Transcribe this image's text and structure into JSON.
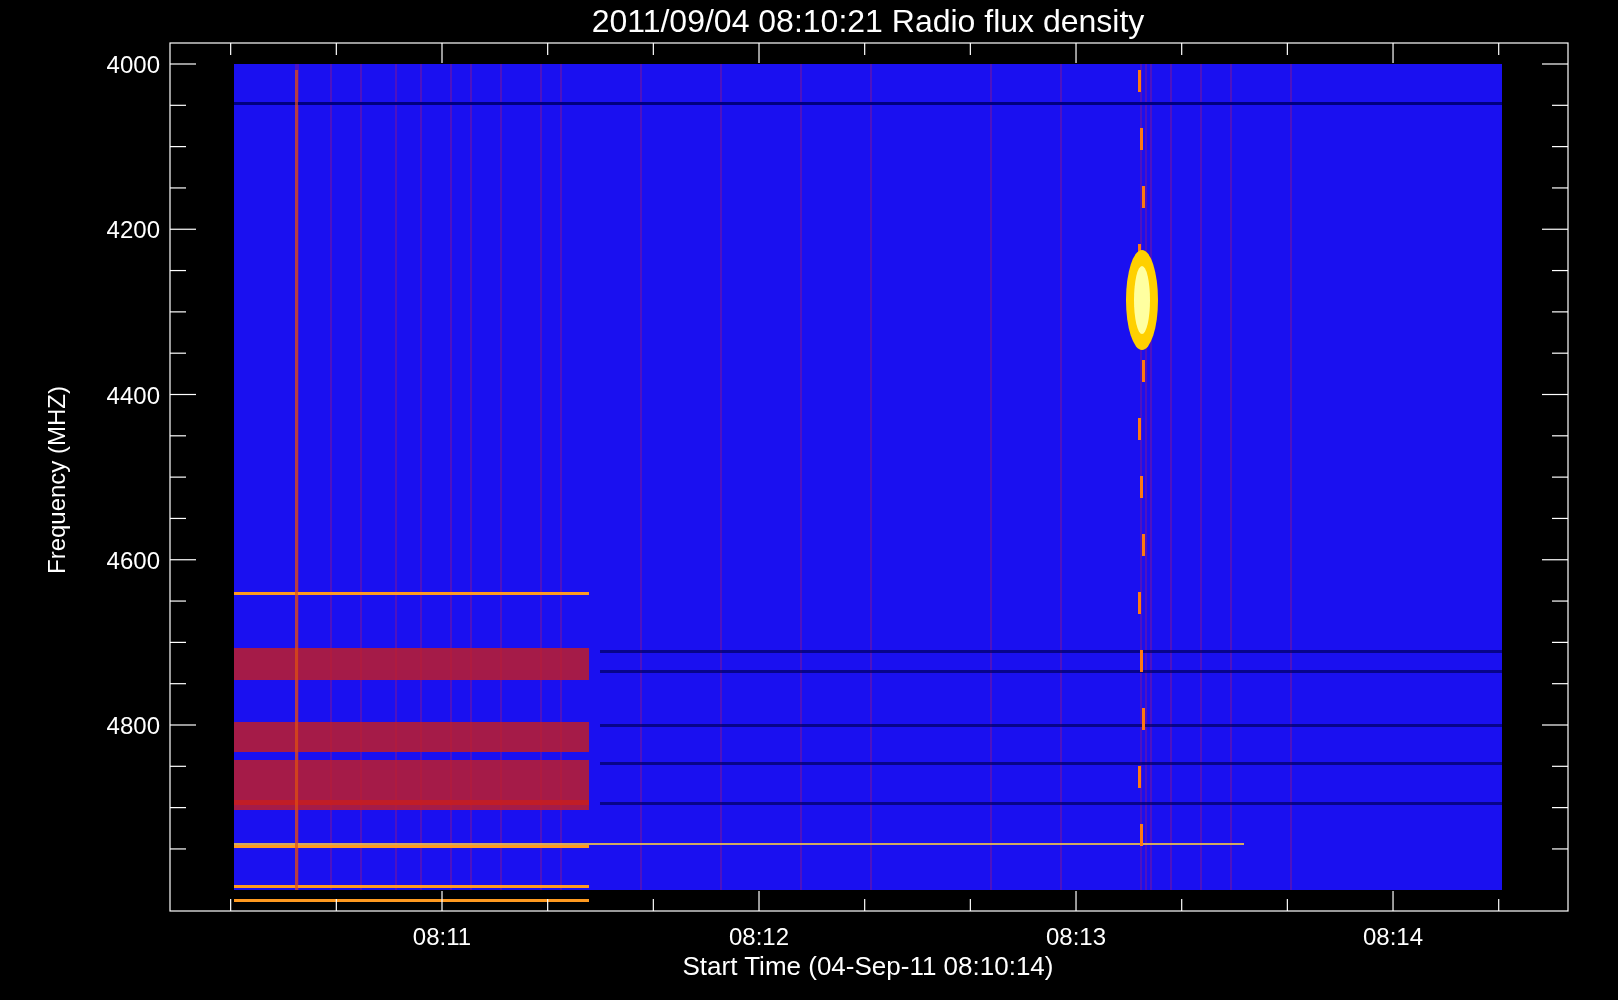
{
  "title": "2011/09/04 08:10:21 Radio flux density",
  "y_axis": {
    "label": "Frequency (MHZ)",
    "ticks": [
      "4000",
      "4200",
      "4400",
      "4600",
      "4800"
    ]
  },
  "x_axis": {
    "label": "Start Time (04-Sep-11 08:10:14)",
    "ticks": [
      "08:11",
      "08:12",
      "08:13",
      "08:14"
    ]
  }
}
